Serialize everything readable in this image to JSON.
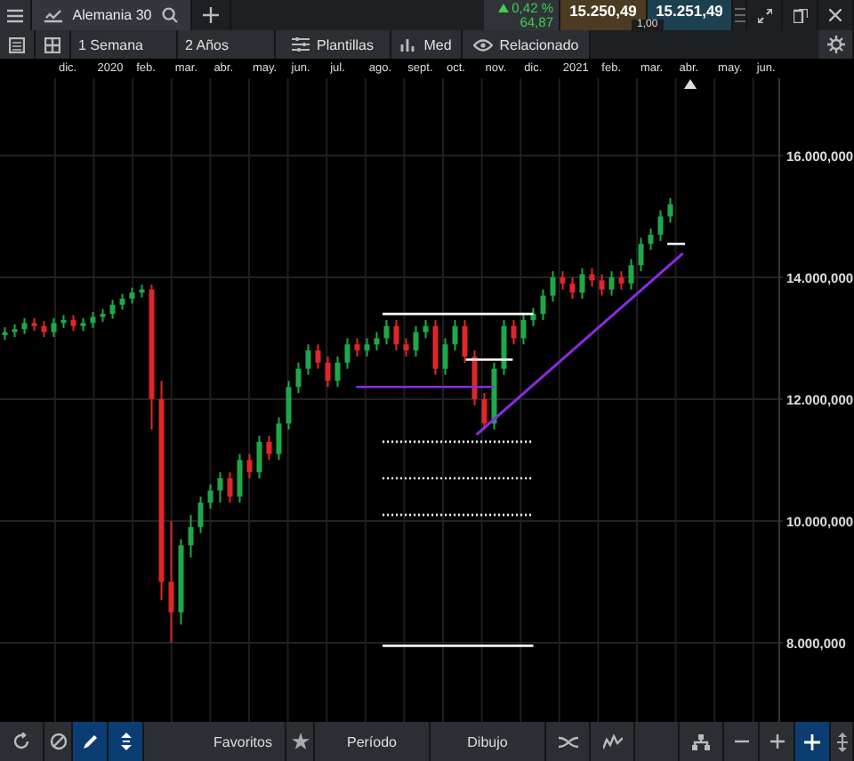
{
  "header": {
    "tab": {
      "title": "Alemania 30"
    },
    "change": {
      "percent": "0,42 %",
      "points": "64,87"
    },
    "sell": "15.250,49",
    "buy": "15.251,49",
    "spread": "1,00"
  },
  "toolbar": {
    "period": "1 Semana",
    "range": "2 Años",
    "templates": "Plantillas",
    "studies": "Med",
    "related": "Relacionado"
  },
  "months": [
    "dic.",
    "2020",
    "feb.",
    "mar.",
    "abr.",
    "may.",
    "jun.",
    "jul.",
    "ago.",
    "sept.",
    "oct.",
    "nov.",
    "dic.",
    "2021",
    "feb.",
    "mar.",
    "abr.",
    "may.",
    "jun."
  ],
  "chart_data": {
    "type": "candlestick",
    "grid": true,
    "ylim": [
      6700,
      17270
    ],
    "yticks": [
      {
        "value": 16000,
        "label": "16.000,000"
      },
      {
        "value": 14000,
        "label": "14.000,000"
      },
      {
        "value": 12000,
        "label": "12.000,000"
      },
      {
        "value": 10000,
        "label": "10.000,000"
      },
      {
        "value": 8000,
        "label": "8.000,000"
      }
    ],
    "categories": [
      null,
      null,
      null,
      null,
      null,
      null,
      null,
      null,
      null,
      null,
      null,
      null,
      null,
      null,
      null,
      null,
      null,
      null,
      null,
      null,
      null,
      null,
      null,
      null,
      null,
      null,
      null,
      null,
      null,
      null,
      null,
      null,
      null,
      null,
      null,
      null,
      null,
      null,
      null,
      null,
      null,
      null,
      null,
      null,
      null,
      null,
      null,
      null,
      null,
      null,
      null,
      null,
      null,
      null,
      null,
      null,
      null,
      null,
      null,
      null,
      null,
      null,
      null,
      null,
      null,
      null,
      null,
      null,
      null,
      null,
      null,
      null,
      null,
      null,
      null,
      null,
      null,
      null,
      null,
      null
    ],
    "ohlc": [
      [
        13050,
        13180,
        12970,
        13100
      ],
      [
        13100,
        13230,
        13020,
        13150
      ],
      [
        13150,
        13330,
        13070,
        13250
      ],
      [
        13250,
        13330,
        13120,
        13200
      ],
      [
        13200,
        13280,
        13020,
        13100
      ],
      [
        13100,
        13330,
        13020,
        13250
      ],
      [
        13250,
        13380,
        13170,
        13300
      ],
      [
        13300,
        13380,
        13120,
        13200
      ],
      [
        13200,
        13330,
        13120,
        13250
      ],
      [
        13250,
        13430,
        13170,
        13350
      ],
      [
        13350,
        13480,
        13270,
        13400
      ],
      [
        13400,
        13630,
        13320,
        13550
      ],
      [
        13550,
        13730,
        13470,
        13650
      ],
      [
        13650,
        13830,
        13570,
        13750
      ],
      [
        13750,
        13880,
        13670,
        13800
      ],
      [
        13800,
        13880,
        11500,
        12000
      ],
      [
        12000,
        12300,
        8700,
        9000
      ],
      [
        9000,
        10000,
        8000,
        8500
      ],
      [
        8500,
        9700,
        8300,
        9600
      ],
      [
        9600,
        10100,
        9400,
        9900
      ],
      [
        9900,
        10400,
        9800,
        10300
      ],
      [
        10300,
        10600,
        10200,
        10500
      ],
      [
        10500,
        10800,
        10300,
        10700
      ],
      [
        10700,
        10800,
        10300,
        10400
      ],
      [
        10400,
        11100,
        10300,
        11000
      ],
      [
        11000,
        11100,
        10700,
        10800
      ],
      [
        10800,
        11400,
        10700,
        11300
      ],
      [
        11300,
        11400,
        11000,
        11100
      ],
      [
        11100,
        11700,
        11000,
        11600
      ],
      [
        11600,
        12300,
        11500,
        12200
      ],
      [
        12200,
        12600,
        12100,
        12500
      ],
      [
        12500,
        12900,
        12400,
        12800
      ],
      [
        12800,
        12900,
        12500,
        12600
      ],
      [
        12600,
        12700,
        12200,
        12300
      ],
      [
        12300,
        12700,
        12200,
        12600
      ],
      [
        12600,
        13000,
        12500,
        12900
      ],
      [
        12900,
        13000,
        12700,
        12800
      ],
      [
        12800,
        13000,
        12700,
        12900
      ],
      [
        12900,
        13100,
        12800,
        13000
      ],
      [
        13000,
        13300,
        12900,
        13200
      ],
      [
        13200,
        13300,
        12800,
        12900
      ],
      [
        12900,
        13000,
        12700,
        12800
      ],
      [
        12800,
        13200,
        12700,
        13100
      ],
      [
        13100,
        13300,
        13000,
        13200
      ],
      [
        13200,
        13300,
        12400,
        12500
      ],
      [
        12500,
        13000,
        12400,
        12900
      ],
      [
        12900,
        13300,
        12800,
        13200
      ],
      [
        13200,
        13300,
        12600,
        12700
      ],
      [
        12700,
        12800,
        11900,
        12000
      ],
      [
        12000,
        12100,
        11500,
        11600
      ],
      [
        11600,
        12600,
        11500,
        12500
      ],
      [
        12500,
        13300,
        12400,
        13200
      ],
      [
        13200,
        13300,
        12900,
        13000
      ],
      [
        13000,
        13400,
        12900,
        13300
      ],
      [
        13300,
        13500,
        13200,
        13400
      ],
      [
        13400,
        13800,
        13300,
        13700
      ],
      [
        13700,
        14100,
        13600,
        14000
      ],
      [
        14000,
        14100,
        13800,
        13900
      ],
      [
        13900,
        14000,
        13650,
        13750
      ],
      [
        13750,
        14150,
        13650,
        14050
      ],
      [
        14050,
        14150,
        13850,
        13950
      ],
      [
        13950,
        14050,
        13700,
        13800
      ],
      [
        13800,
        14100,
        13700,
        14000
      ],
      [
        14000,
        14100,
        13800,
        13900
      ],
      [
        13900,
        14300,
        13800,
        14200
      ],
      [
        14200,
        14650,
        14100,
        14550
      ],
      [
        14550,
        14800,
        14450,
        14700
      ],
      [
        14700,
        15100,
        14600,
        15000
      ],
      [
        15000,
        15300,
        14900,
        15200
      ],
      null,
      null,
      null,
      null,
      null,
      null,
      null,
      null,
      null,
      null,
      null
    ]
  },
  "bottom_bar": {
    "favorites": "Favoritos",
    "period": "Período",
    "drawing": "Dibujo",
    "tools": [
      {
        "selected": false
      },
      {
        "selected": false
      },
      {
        "selected": true
      },
      {
        "selected": true
      }
    ],
    "right_tools": [
      {
        "selected": false
      },
      {
        "selected": false
      },
      {
        "selected": false
      },
      {
        "selected": false
      },
      {
        "selected": false
      },
      {
        "selected": false
      },
      {
        "selected": true
      }
    ]
  }
}
